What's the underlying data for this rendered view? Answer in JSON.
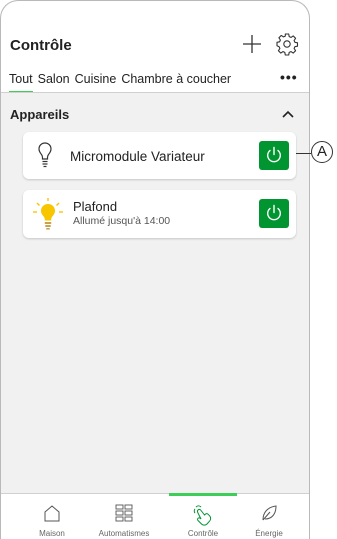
{
  "header": {
    "title": "Contrôle"
  },
  "tabs": [
    "Tout",
    "Salon",
    "Cuisine",
    "Chambre à coucher"
  ],
  "section": {
    "title": "Appareils"
  },
  "devices": [
    {
      "name": "Micromodule Variateur"
    },
    {
      "name": "Plafond",
      "status": "Allumé jusqu'à 14:00"
    }
  ],
  "callout": "A",
  "bottom_nav": [
    {
      "label": "Maison",
      "icon": "home-icon"
    },
    {
      "label": "Automatismes",
      "icon": "grid-icon"
    },
    {
      "label": "Contrôle",
      "icon": "hand-touch-icon",
      "active": true
    },
    {
      "label": "Énergie",
      "icon": "leaf-icon"
    }
  ],
  "colors": {
    "accent": "#3dcd58",
    "power": "#009530",
    "bulb": "#f7c600"
  }
}
